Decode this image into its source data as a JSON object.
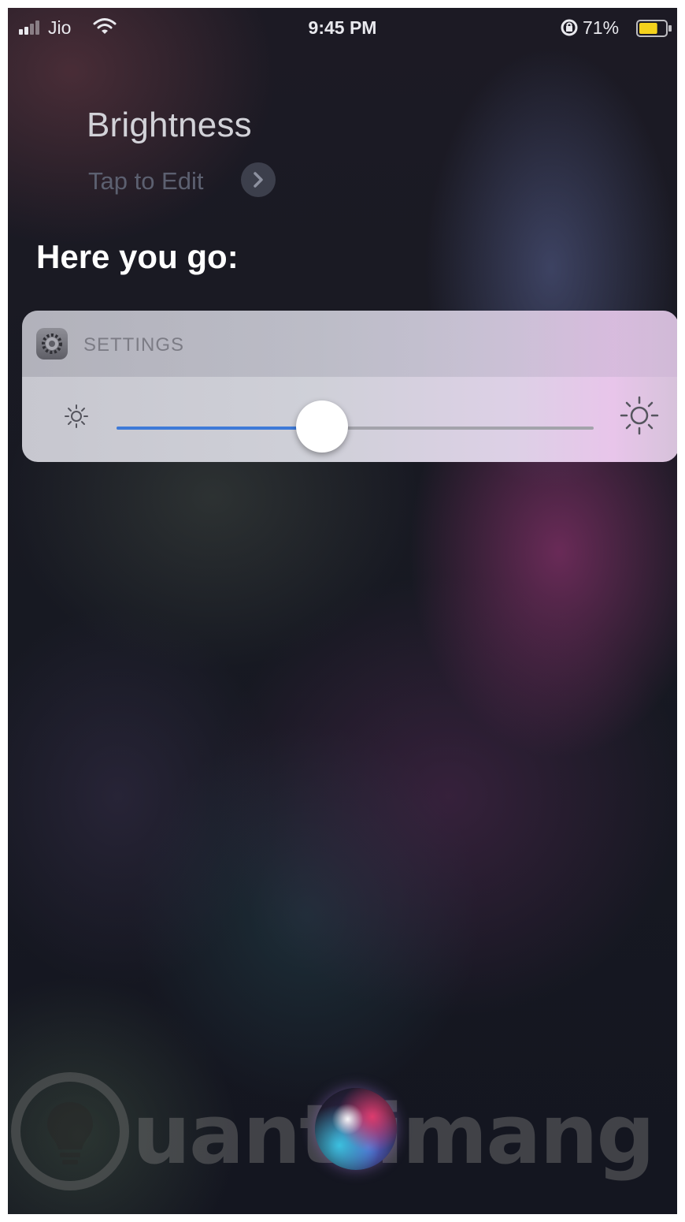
{
  "status_bar": {
    "carrier": "Jio",
    "time": "9:45 PM",
    "battery_percent": "71%",
    "battery_level": 0.71,
    "signal_bars": 2,
    "icons": [
      "signal-icon",
      "wifi-icon",
      "rotation-lock-icon",
      "battery-icon"
    ]
  },
  "siri": {
    "query": "Brightness",
    "edit_hint": "Tap to Edit",
    "response": "Here you go:"
  },
  "card": {
    "app_label": "SETTINGS",
    "app_icon": "settings-gear-icon",
    "brightness_level": 0.43,
    "min_icon": "sun-small-icon",
    "max_icon": "sun-large-icon",
    "accent_color": "#3e7ad8"
  },
  "watermark": {
    "text": "uantrimang",
    "icon": "lightbulb-icon"
  }
}
